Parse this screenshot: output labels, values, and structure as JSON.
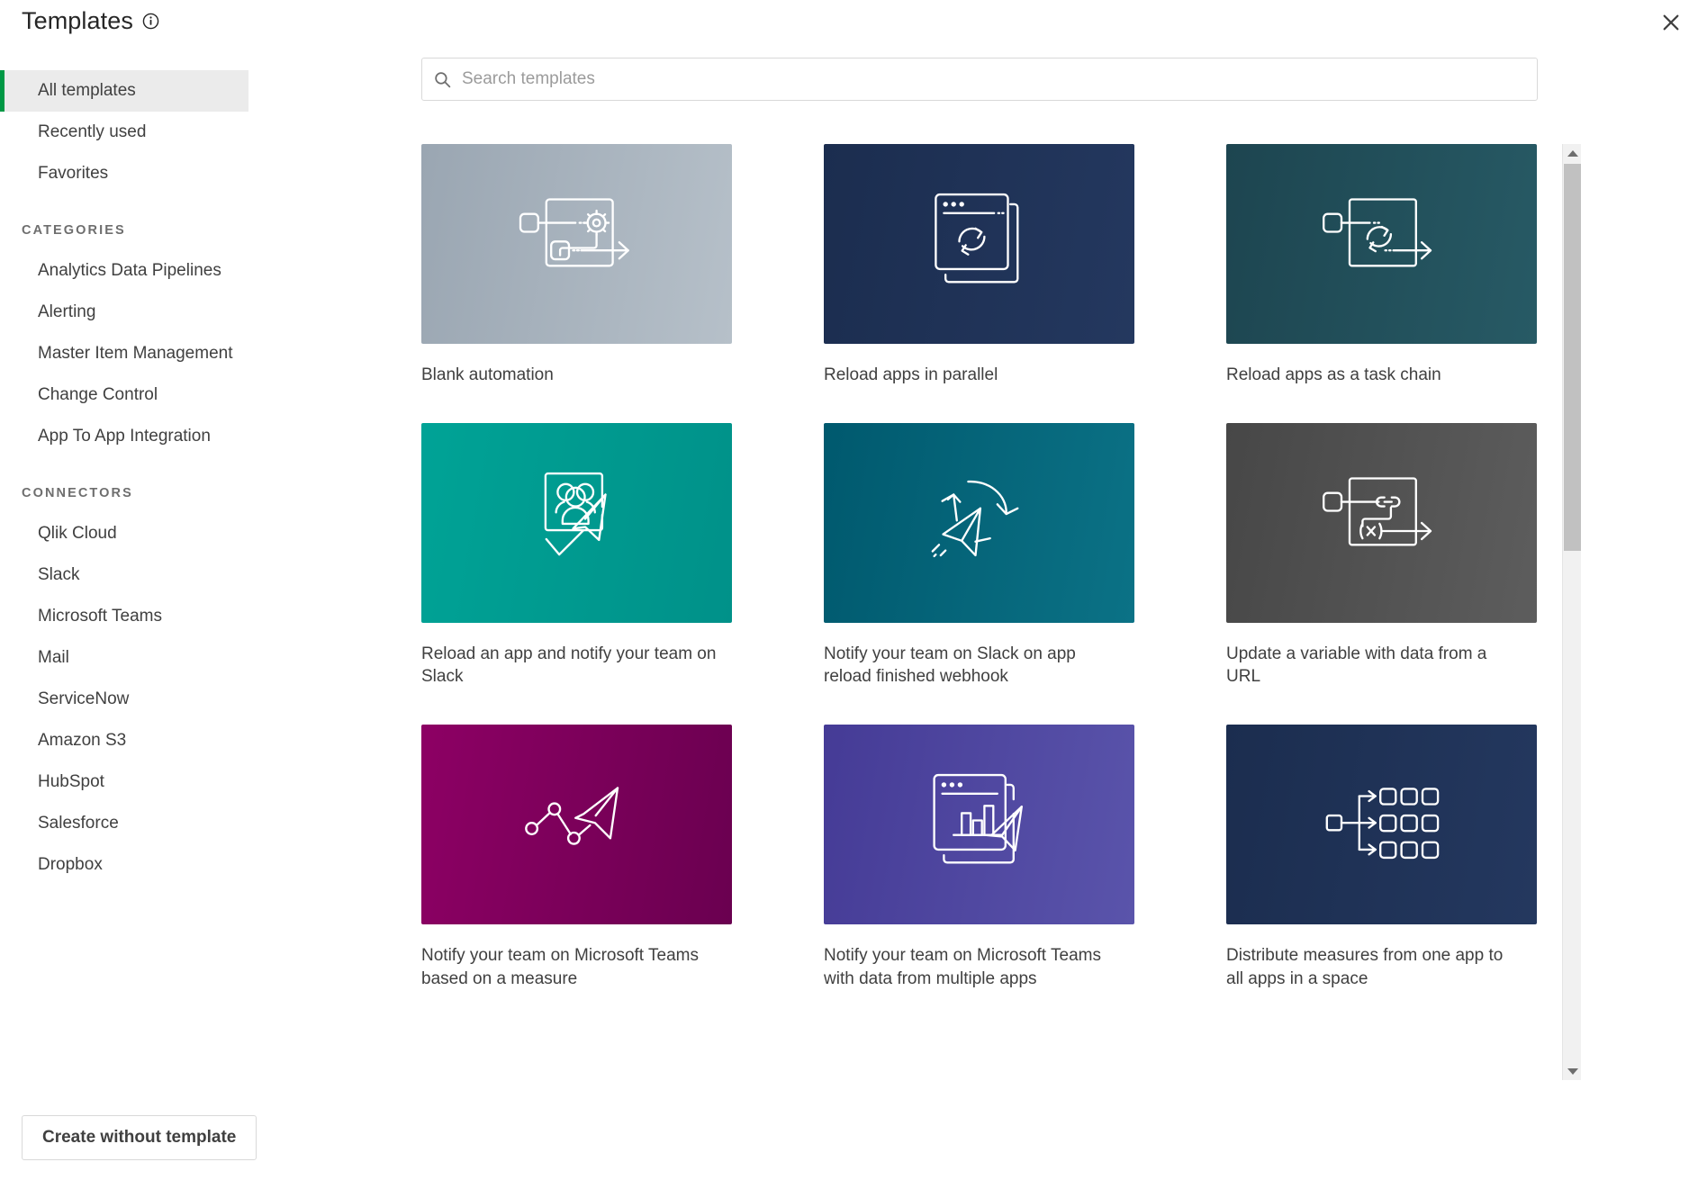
{
  "header": {
    "title": "Templates",
    "info_icon": "info-circle-icon",
    "close_icon": "close-icon"
  },
  "sidebar": {
    "nav": [
      {
        "label": "All templates",
        "active": true
      },
      {
        "label": "Recently used",
        "active": false
      },
      {
        "label": "Favorites",
        "active": false
      }
    ],
    "categories_title": "CATEGORIES",
    "categories": [
      {
        "label": "Analytics Data Pipelines"
      },
      {
        "label": "Alerting"
      },
      {
        "label": "Master Item Management"
      },
      {
        "label": "Change Control"
      },
      {
        "label": "App To App Integration"
      }
    ],
    "connectors_title": "CONNECTORS",
    "connectors": [
      {
        "label": "Qlik Cloud"
      },
      {
        "label": "Slack"
      },
      {
        "label": "Microsoft Teams"
      },
      {
        "label": "Mail"
      },
      {
        "label": "ServiceNow"
      },
      {
        "label": "Amazon S3"
      },
      {
        "label": "HubSpot"
      },
      {
        "label": "Salesforce"
      },
      {
        "label": "Dropbox"
      }
    ]
  },
  "search": {
    "placeholder": "Search templates",
    "value": "",
    "icon": "search-icon"
  },
  "templates": [
    {
      "title": "Blank automation",
      "icon": "workflow-gear-icon",
      "gradient_from": "#9aa6b2",
      "gradient_to": "#b3bdc7"
    },
    {
      "title": "Reload apps in parallel",
      "icon": "stacked-windows-reload-icon",
      "gradient_from": "#1b2d4f",
      "gradient_to": "#22365c"
    },
    {
      "title": "Reload apps as a task chain",
      "icon": "workflow-reload-icon",
      "gradient_from": "#1d4550",
      "gradient_to": "#245660"
    },
    {
      "title": "Reload an app and notify your team on Slack",
      "icon": "people-paperplane-icon",
      "gradient_from": "#00a094",
      "gradient_to": "#00948b"
    },
    {
      "title": "Notify your team on Slack on app reload finished webhook",
      "icon": "paperplane-arrow-icon",
      "gradient_from": "#00596e",
      "gradient_to": "#0a6c80"
    },
    {
      "title": "Update a variable with data from a URL",
      "icon": "workflow-variable-link-icon",
      "gradient_from": "#4a4a4a",
      "gradient_to": "#5a5a5a"
    },
    {
      "title": "Notify your team on Microsoft Teams based on a measure",
      "icon": "linechart-paperplane-icon",
      "gradient_from": "#8c0063",
      "gradient_to": "#6d0052"
    },
    {
      "title": "Notify your team on Microsoft Teams with data from multiple apps",
      "icon": "barchart-window-paperplane-icon",
      "gradient_from": "#463c97",
      "gradient_to": "#5751a8"
    },
    {
      "title": "Distribute measures from one app to all apps in a space",
      "icon": "distribute-grid-icon",
      "gradient_from": "#1b2d4f",
      "gradient_to": "#22365c"
    }
  ],
  "scrollbar": {
    "up_icon": "chevron-up-icon",
    "down_icon": "chevron-down-icon"
  },
  "footer": {
    "create_without_template_label": "Create without template"
  },
  "colors": {
    "accent_green": "#009845",
    "text_primary": "#404040",
    "text_muted": "#6e6e6e"
  }
}
